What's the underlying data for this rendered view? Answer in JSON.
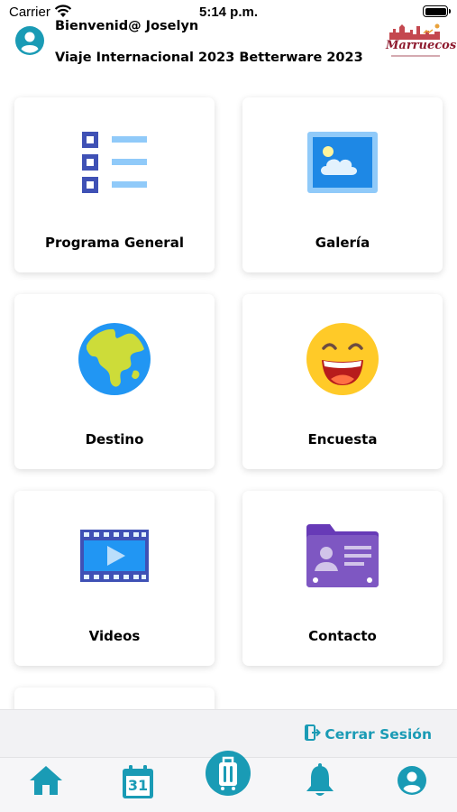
{
  "status_bar": {
    "carrier": "Carrier",
    "time": "5:14 p.m."
  },
  "header": {
    "greeting": "Bienvenid@ Joselyn",
    "trip_title": "Viaje Internacional 2023 Betterware 2023",
    "logo_text": "Marruecos"
  },
  "menu": {
    "items": [
      {
        "label": "Programa General",
        "icon": "list-icon"
      },
      {
        "label": "Galería",
        "icon": "image-icon"
      },
      {
        "label": "Destino",
        "icon": "globe-icon"
      },
      {
        "label": "Encuesta",
        "icon": "smiley-icon"
      },
      {
        "label": "Videos",
        "icon": "film-icon"
      },
      {
        "label": "Contacto",
        "icon": "contact-card-icon"
      }
    ]
  },
  "footer": {
    "logout_label": "Cerrar Sesión",
    "calendar_day": "31"
  },
  "tabbar": {
    "tabs": [
      {
        "icon": "home-icon"
      },
      {
        "icon": "calendar-icon"
      },
      {
        "icon": "luggage-icon",
        "active": true
      },
      {
        "icon": "bell-icon"
      },
      {
        "icon": "profile-icon"
      }
    ]
  },
  "colors": {
    "accent": "#1a9bb5",
    "card_background": "#ffffff",
    "footer_background": "#f2f2f4"
  }
}
